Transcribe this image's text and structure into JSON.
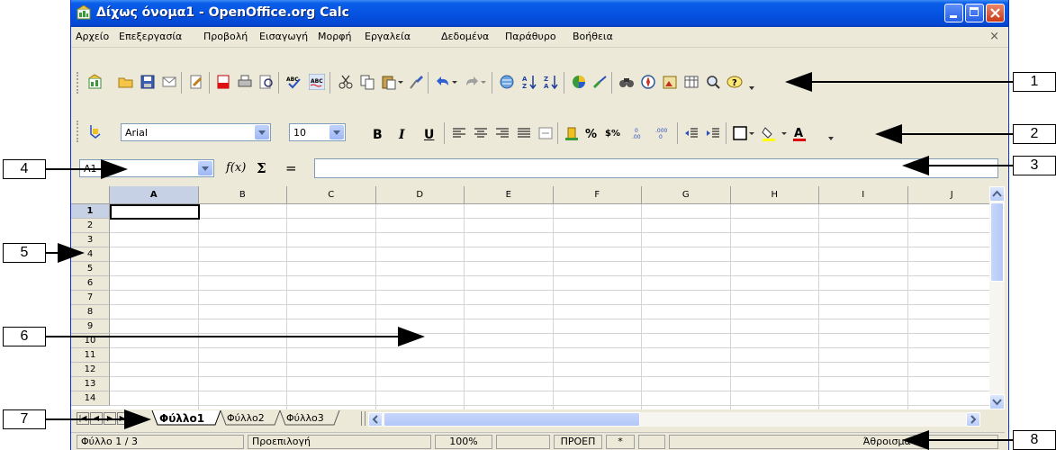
{
  "window": {
    "title": "Δίχως όνομα1 - OpenOffice.org Calc",
    "close_doc": "×"
  },
  "menu": [
    "Αρχείο",
    "Επεξεργασία",
    "Προβολή",
    "Εισαγωγή",
    "Μορφή",
    "Εργαλεία",
    "Δεδομένα",
    "Παράθυρο",
    "Βοήθεια"
  ],
  "format_toolbar": {
    "font_name": "Arial",
    "font_size": "10",
    "bold": "B",
    "italic": "I",
    "underline": "U",
    "percent": "%",
    "currency": "$%"
  },
  "formula_bar": {
    "name_box": "A1",
    "function_icon": "f(x)",
    "sum_icon": "Σ",
    "equals": "=",
    "content": ""
  },
  "columns": [
    "A",
    "B",
    "C",
    "D",
    "E",
    "F",
    "G",
    "H",
    "I",
    "J"
  ],
  "rows": [
    "1",
    "2",
    "3",
    "4",
    "5",
    "6",
    "7",
    "8",
    "9",
    "10",
    "11",
    "12",
    "13",
    "14"
  ],
  "sheet_tabs": [
    "Φύλλο1",
    "Φύλλο2",
    "Φύλλο3"
  ],
  "active_sheet": "Φύλλο1",
  "status": {
    "sheet": "Φύλλο 1 / 3",
    "style": "Προεπιλογή",
    "zoom": "100%",
    "mode": "ΠΡΟΕΠ",
    "modified": "*",
    "sum": "Άθροισμα=0"
  },
  "callouts": [
    "1",
    "2",
    "3",
    "4",
    "5",
    "6",
    "7",
    "8"
  ],
  "colors": {
    "title_bar": "#0553e1",
    "face": "#ece9d8",
    "selected_header": "#c7d1e6"
  }
}
